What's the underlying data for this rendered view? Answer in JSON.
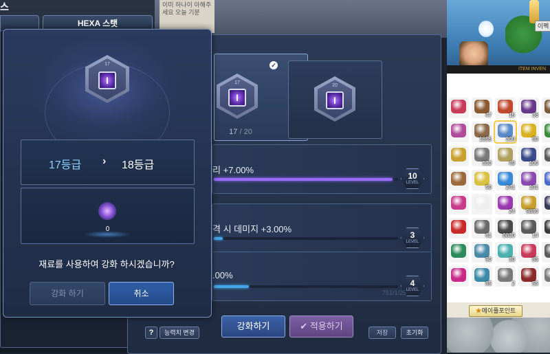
{
  "background": {
    "title_partial": "스",
    "tab_hexa_stat": "HEXA 스탯",
    "note_text": "이미 하나이 아해주세요 오늘 기분",
    "inventory_button": "이펙",
    "inventory_title": "ITEM INVEN",
    "maple_point": "메이플포인트"
  },
  "hexa_panel": {
    "cards": [
      {
        "grade": "17",
        "count_current": "17",
        "count_sep": " / ",
        "count_max": "20",
        "selected": true
      },
      {
        "grade": "20",
        "selected": false
      }
    ],
    "stats": [
      {
        "text": "리 +7.00%",
        "level": "10",
        "level_label": "LEVEL",
        "fill_fraction": 0.97,
        "color": "#9b6bff"
      },
      {
        "text": "격 시 데미지 +3.00%",
        "level": "3",
        "level_label": "LEVEL",
        "fill_fraction": 0.05,
        "color": "#45a6e8"
      },
      {
        "text": ".00%",
        "level": "4",
        "level_label": "LEVEL",
        "fill_fraction": 0.19,
        "color": "#45a6e8"
      }
    ],
    "faint_text": "751/1/25",
    "help_button": "?",
    "stat_change_button": "능력치 변경",
    "enhance_button": "강화하기",
    "apply_button": "✔ 적용하기",
    "save_button": "저장",
    "reset_button": "초기화"
  },
  "modal": {
    "skill_grade": "17",
    "grade_from": "17등급",
    "arrow": "›",
    "grade_to": "18등급",
    "material_count": "0",
    "question": "재료를 사용하여 강화 하시겠습니까?",
    "confirm_button": "강화 하기",
    "cancel_button": "취소"
  },
  "inventory": {
    "items": [
      {
        "qty": "",
        "color": "#c83a5a"
      },
      {
        "qty": "47",
        "color": "#8a5a30"
      },
      {
        "qty": "15",
        "color": "#c04a30"
      },
      {
        "qty": "36",
        "color": "#6a3a8a"
      },
      {
        "qty": "26",
        "color": "#7a5a3a"
      },
      {
        "qty": "",
        "color": "#b04a9a"
      },
      {
        "qty": "1855",
        "color": "#8a6a4a"
      },
      {
        "qty": "300",
        "color": "#5a8ac8"
      },
      {
        "qty": "50",
        "color": "#d8b020"
      },
      {
        "qty": "96",
        "color": "#3a8a3a"
      },
      {
        "qty": "",
        "color": "#c8a030"
      },
      {
        "qty": "530",
        "color": "#7a7a7a"
      },
      {
        "qty": "49",
        "color": "#b0a060"
      },
      {
        "qty": "100",
        "color": "#3a4a8a"
      },
      {
        "qty": "4",
        "color": "#5a5a5a"
      },
      {
        "qty": "",
        "color": "#9a6a3a"
      },
      {
        "qty": "50",
        "color": "#d8c040"
      },
      {
        "qty": "241",
        "color": "#3a8ad8"
      },
      {
        "qty": "101",
        "color": "#8a4ab0"
      },
      {
        "qty": "2",
        "color": "#4a6ac8"
      },
      {
        "qty": "",
        "color": "#c83a8a"
      },
      {
        "qty": "",
        "color": "#eeeeee"
      },
      {
        "qty": "24",
        "color": "#9a3ab0"
      },
      {
        "qty": "9880",
        "color": "#c8a030"
      },
      {
        "qty": "",
        "color": "#3a3a5a"
      },
      {
        "qty": "",
        "color": "#c82a2a"
      },
      {
        "qty": "61",
        "color": "#6a6a6a"
      },
      {
        "qty": "0830",
        "color": "#4a4a4a"
      },
      {
        "qty": "14",
        "color": "#5a5a5a"
      },
      {
        "qty": "2",
        "color": "#3a3a3a"
      },
      {
        "qty": "",
        "color": "#2a8a5a"
      },
      {
        "qty": "90",
        "color": "#4a8aa8"
      },
      {
        "qty": "30",
        "color": "#4ab0b0"
      },
      {
        "qty": "85",
        "color": "#c83a5a"
      },
      {
        "qty": "",
        "color": "#5a5a5a"
      },
      {
        "qty": "",
        "color": "#c82a8a"
      },
      {
        "qty": "85",
        "color": "#3a8aa8"
      },
      {
        "qty": "2",
        "color": "#7a7a7a"
      },
      {
        "qty": "55",
        "color": "#8a2a2a"
      },
      {
        "qty": "",
        "color": "#7a7a7a"
      }
    ]
  }
}
